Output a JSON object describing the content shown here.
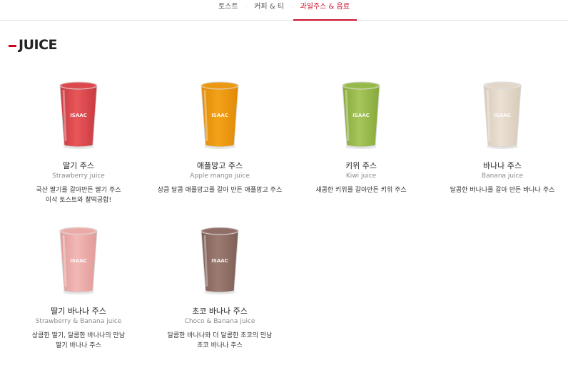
{
  "nav": {
    "tabs": [
      {
        "label": "토스트"
      },
      {
        "label": "커피 & 티"
      },
      {
        "label": "과일주스 & 음료"
      }
    ],
    "active_index": 2,
    "separator": "·"
  },
  "section": {
    "title": "JUICE"
  },
  "products": [
    {
      "name": "딸기 주스",
      "eng": "Strawberry juice",
      "desc": "국산 딸기를 갈아만든 딸기 주스\n이삭 토스트와 찰떡궁합!",
      "cup_text": "ISAAC",
      "color": "#e8565a",
      "color_dark": "#c73a40"
    },
    {
      "name": "애플망고 주스",
      "eng": "Apple mango juice",
      "desc": "상큼 달콤 애플망고를 갈아 만든 애플망고 주스",
      "cup_text": "ISAAC",
      "color": "#f4a21a",
      "color_dark": "#e08a06"
    },
    {
      "name": "키위 주스",
      "eng": "Kiwi juice",
      "desc": "새콤한 키위를 갈아만든 키위 주스",
      "cup_text": "ISAAC",
      "color": "#a6c55a",
      "color_dark": "#86a83a"
    },
    {
      "name": "바나나 주스",
      "eng": "Banana juice",
      "desc": "달콤한 바나나를 갈아 만든 바나나 주스",
      "cup_text": "ISAAC",
      "color": "#eae0d4",
      "color_dark": "#d8cab8"
    },
    {
      "name": "딸기 바나나 주스",
      "eng": "Strawberry & Banana juice",
      "desc": "상큼한 딸기, 달콤한 바나나의 만남\n딸기 바나나 주스",
      "cup_text": "ISAAC",
      "color": "#f2b8b5",
      "color_dark": "#e09a97"
    },
    {
      "name": "초코 바나나 주스",
      "eng": "Choco & Banana juice",
      "desc": "달콤한 바나나와 더 달콤한 초코의 만남\n초코 바나나 주스",
      "cup_text": "ISAAC",
      "color": "#9b7b72",
      "color_dark": "#7e5f56"
    }
  ]
}
